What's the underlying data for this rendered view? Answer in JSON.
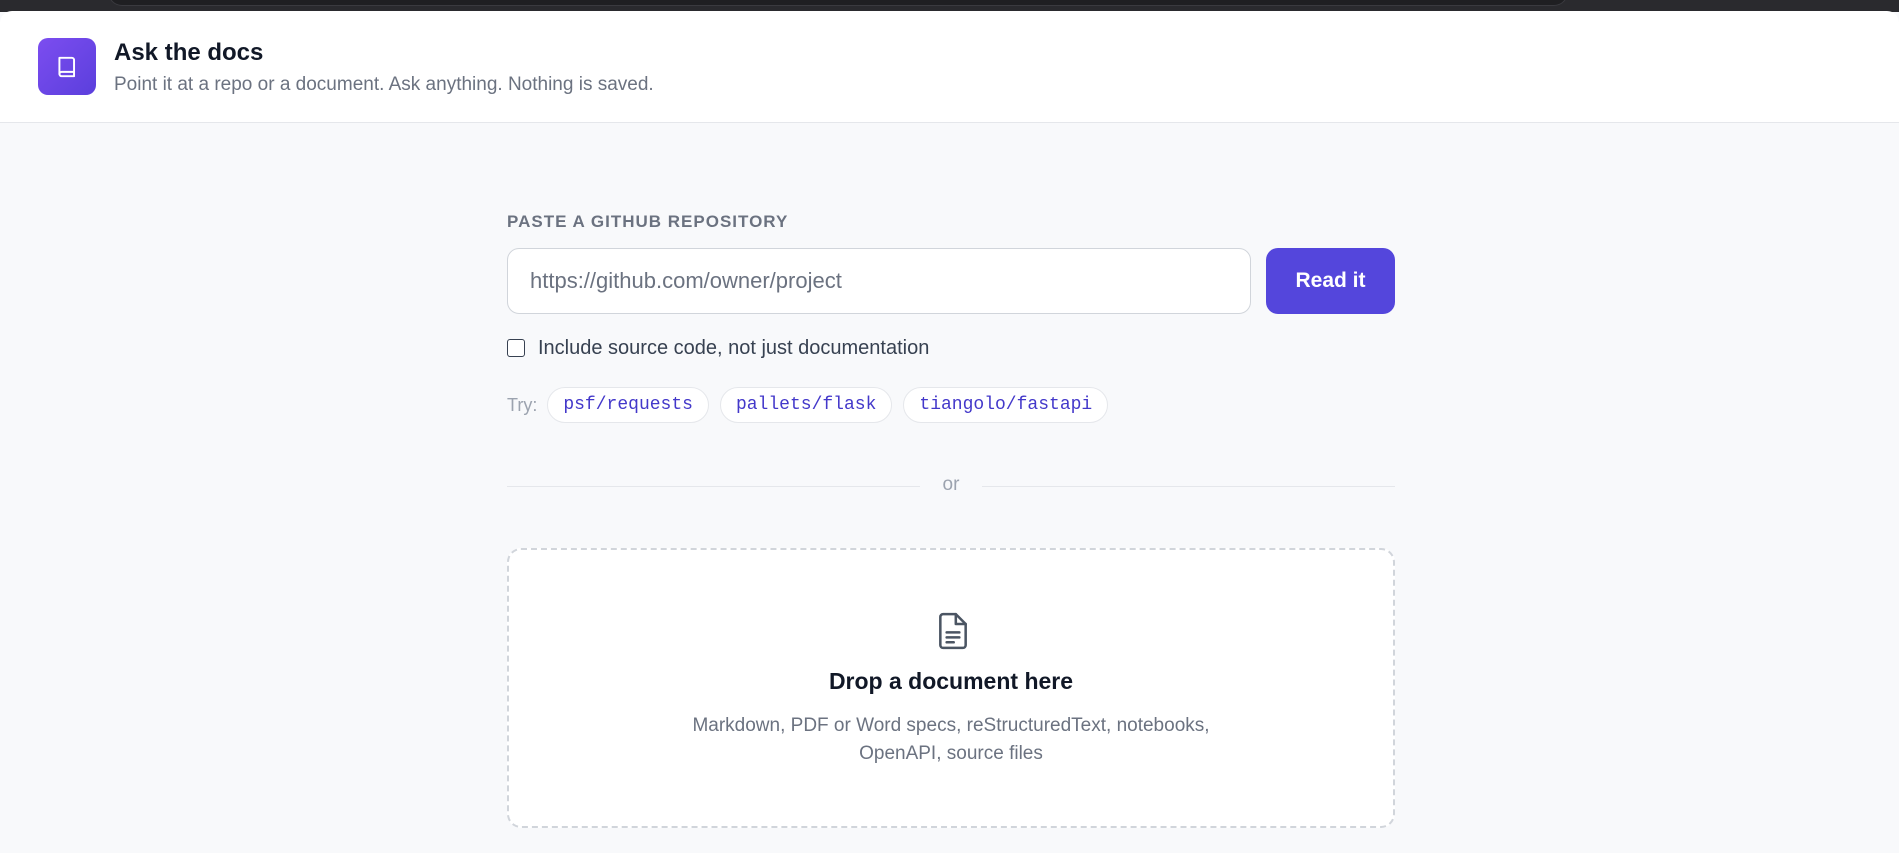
{
  "header": {
    "logo_icon": "book-icon",
    "title": "Ask the docs",
    "subtitle": "Point it at a repo or a document. Ask anything. Nothing is saved."
  },
  "repo": {
    "section_label": "PASTE A GITHUB REPOSITORY",
    "input_value": "",
    "input_placeholder": "https://github.com/owner/project",
    "submit_label": "Read it",
    "include_source_label": "Include source code, not just documentation",
    "include_source_checked": false,
    "try_label": "Try:",
    "examples": [
      "psf/requests",
      "pallets/flask",
      "tiangolo/fastapi"
    ]
  },
  "divider": {
    "label": "or"
  },
  "dropzone": {
    "icon": "document-icon",
    "title": "Drop a document here",
    "description": "Markdown, PDF or Word specs, reStructuredText, notebooks, OpenAPI, source files"
  },
  "colors": {
    "accent": "#5446dc",
    "logo": "#6d45e8",
    "chip_text": "#4338ca",
    "muted_text": "#6b7280",
    "background": "#f8f9fb"
  }
}
